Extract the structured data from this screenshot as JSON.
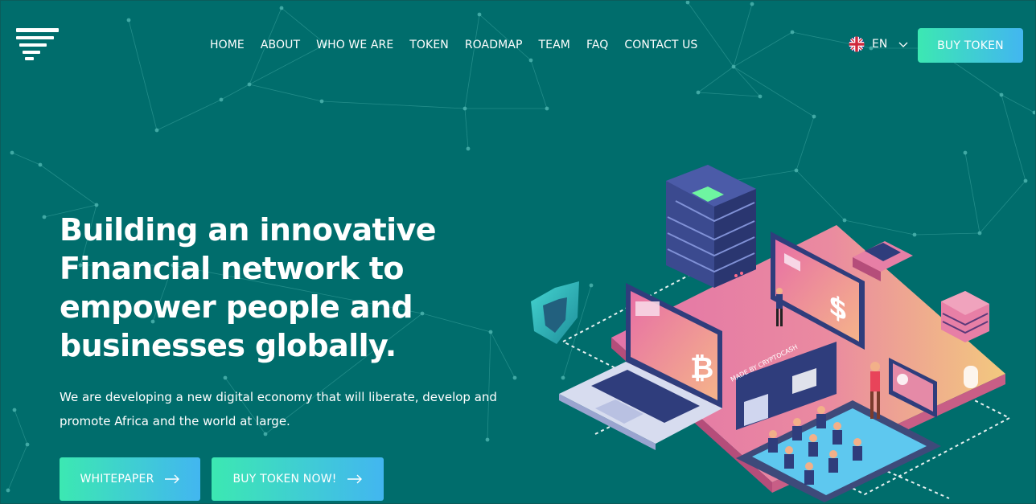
{
  "header": {
    "logo_icon": "stacked-bars-logo-icon",
    "nav": [
      {
        "label": "HOME"
      },
      {
        "label": "ABOUT"
      },
      {
        "label": "WHO WE ARE"
      },
      {
        "label": "TOKEN"
      },
      {
        "label": "ROADMAP"
      },
      {
        "label": "TEAM"
      },
      {
        "label": "FAQ"
      },
      {
        "label": "CONTACT US"
      }
    ],
    "language": {
      "label": "EN",
      "flag_icon": "uk-flag-icon",
      "dropdown_icon": "chevron-down-icon"
    },
    "buy_token_label": "BUY TOKEN"
  },
  "hero": {
    "title": "Building an innovative Financial network to empower people and businesses globally.",
    "subtitle": "We are developing a new digital economy that will liberate, develop and promote Africa and the world at large.",
    "whitepaper_label": "WHITEPAPER",
    "buy_now_label": "BUY TOKEN NOW!",
    "arrow_icon": "arrow-right-icon"
  },
  "illustration": {
    "screen_text": "MADE BY CRYPTOCASH",
    "bitcoin_symbol": "₿",
    "dollar_symbol": "$"
  },
  "colors": {
    "background": "#006d6c",
    "gradient_start": "#3ce8b2",
    "gradient_end": "#42b6f0",
    "platform_pink": "#e77fa6",
    "platform_orange": "#f0c27a",
    "device_navy": "#2f3d7c"
  }
}
